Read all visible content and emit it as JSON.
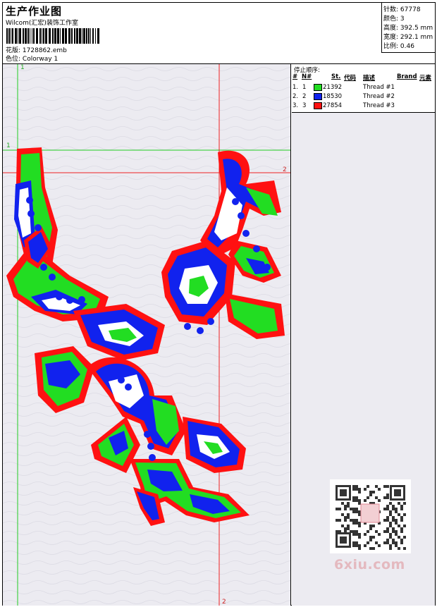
{
  "header": {
    "title": "生产作业图",
    "company": "Wilcom(汇宏)装饰工作室",
    "design_label": "花版:",
    "design_value": "1728862.emb",
    "colorway_label": "色位:",
    "colorway_value": "Colorway 1"
  },
  "stats": {
    "stitches_label": "针数:",
    "stitches_value": "67778",
    "colors_label": "颜色:",
    "colors_value": "3",
    "height_label": "高度:",
    "height_value": "392.5 mm",
    "width_label": "宽度:",
    "width_value": "292.1 mm",
    "scale_label": "比例:",
    "scale_value": "0.46"
  },
  "sequence": {
    "title": "停止顺序:",
    "headers": {
      "hash": "#",
      "no": "N#",
      "st": "St.",
      "code": "代码",
      "desc": "描述",
      "brand": "Brand",
      "element": "元素"
    },
    "rows": [
      {
        "hash": "1.",
        "no": "1",
        "code": "21392",
        "desc": "Thread #1",
        "color": "#22dd22"
      },
      {
        "hash": "2.",
        "no": "2",
        "code": "18530",
        "desc": "Thread #2",
        "color": "#1122ee"
      },
      {
        "hash": "3.",
        "no": "3",
        "code": "27854",
        "desc": "Thread #3",
        "color": "#ff1111"
      }
    ]
  },
  "guides": {
    "green_v": "1",
    "green_h": "1",
    "red_h": "2",
    "red_v": "2"
  },
  "watermark": {
    "text": "6xiu.com"
  }
}
